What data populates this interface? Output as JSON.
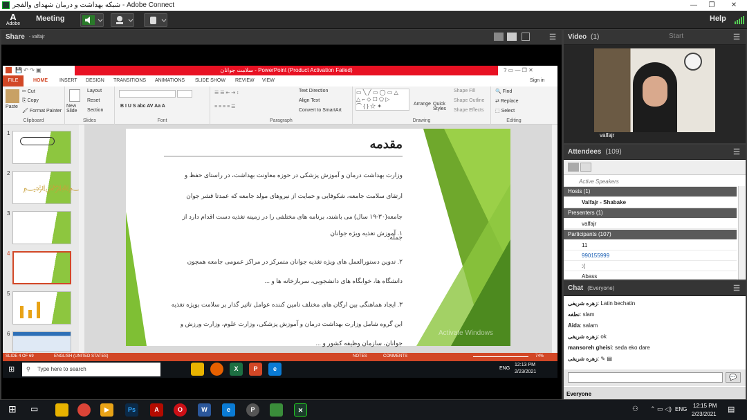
{
  "window": {
    "title": "شبکه بهداشت و درمان شهدای والفجر - Adobe Connect",
    "controls": [
      "—",
      "❐",
      "✕"
    ]
  },
  "menu": {
    "meeting": "Meeting",
    "help": "Help",
    "adobe": "Adobe"
  },
  "share": {
    "title": "Share",
    "owner": "- valfajr"
  },
  "ppt": {
    "title": "سلامت جوانان  -  PowerPoint (Product Activation Failed)",
    "tabs": [
      "FILE",
      "HOME",
      "INSERT",
      "DESIGN",
      "TRANSITIONS",
      "ANIMATIONS",
      "SLIDE SHOW",
      "REVIEW",
      "VIEW"
    ],
    "signin": "Sign in",
    "ribbon": {
      "paste": "Paste",
      "cut": "Cut",
      "copy": "Copy",
      "format_painter": "Format Painter",
      "clipboard": "Clipboard",
      "new_slide": "New Slide",
      "layout": "Layout",
      "reset": "Reset",
      "section": "Section",
      "slides": "Slides",
      "font": "Font",
      "paragraph": "Paragraph",
      "text_direction": "Text Direction",
      "align_text": "Align Text",
      "smartart": "Convert to SmartArt",
      "arrange": "Arrange",
      "quick_styles": "Quick Styles",
      "shape_fill": "Shape Fill",
      "shape_outline": "Shape Outline",
      "shape_effects": "Shape Effects",
      "drawing": "Drawing",
      "find": "Find",
      "replace": "Replace",
      "select": "Select",
      "editing": "Editing"
    },
    "thumbs": [
      "1",
      "2",
      "3",
      "4",
      "5",
      "6"
    ],
    "slide": {
      "heading": "مقدمه",
      "para": "وزارت بهداشت درمان و آموزش پزشکی در حوزه معاونت بهداشت، در راستای حفظ و ارتقای سلامت جامعه، شکوفایی و حمایت از نیروهای مولد جامعه که عمدتا قشر جوان جامعه(۳۰-۱۹ سال) می باشند، برنامه های مختلفی را در زمینه تغذیه دست اقدام دارد از جمله:",
      "item1": "۱. آموزش تغذیه ویژه جوانان",
      "item2": "۲. تدوین دستورالعمل های ویژه تغذیه جوانان متمرکز در مراکز عمومی جامعه همچون دانشگاه ها، خوابگاه های دانشجویی، سربازخانه ها و ...",
      "item3": "۳. ایجاد هماهنگی بین ارگان های مختلف تامین کننده عوامل تاثیر گذار بر سلامت بویژه تغذیه این گروه شامل وزارت بهداشت درمان و آموزش پزشکی، وزارت علوم، وزارت ورزش و جوانان، سازمان وظیفه کشور و ...",
      "watermark": "Activate Windows"
    },
    "status": {
      "slide": "SLIDE 4 OF 69",
      "lang": "ENGLISH (UNITED STATES)",
      "notes": "NOTES",
      "comments": "COMMENTS",
      "zoom": "74%"
    },
    "inner_taskbar": {
      "search": "Type here to search",
      "lang": "ENG",
      "time": "12:13 PM",
      "date": "2/23/2021"
    }
  },
  "video": {
    "title": "Video",
    "count": "(1)",
    "start": "Start",
    "name": "valfajr"
  },
  "attendees": {
    "title": "Attendees",
    "count": "(109)",
    "active": "Active Speakers",
    "hosts": "Hosts (1)",
    "host1": "Valfajr - Shabake",
    "presenters": "Presenters (1)",
    "presenter1": "valfajr",
    "participants": "Participants (107)",
    "p1": "11",
    "p2": "990155999",
    "p3": ":(",
    "p4": "Abass"
  },
  "chat": {
    "title": "Chat",
    "scope": "(Everyone)",
    "lines": [
      {
        "who": "زهره شریفی",
        "msg": ": Latin bechatin"
      },
      {
        "who": "نطفه",
        "msg": ": slam"
      },
      {
        "who": "Aida",
        "msg": ": salam"
      },
      {
        "who": "زهره شریفی",
        "msg": ": ok"
      },
      {
        "who": "mansoreh gheisi",
        "msg": ": seda eko dare"
      },
      {
        "who": "زهره شریفی",
        "msg": ": ✎ ▤"
      }
    ],
    "footer": "Everyone"
  },
  "taskbar": {
    "lang": "ENG",
    "time": "12:15 PM",
    "date": "2/23/2021"
  }
}
